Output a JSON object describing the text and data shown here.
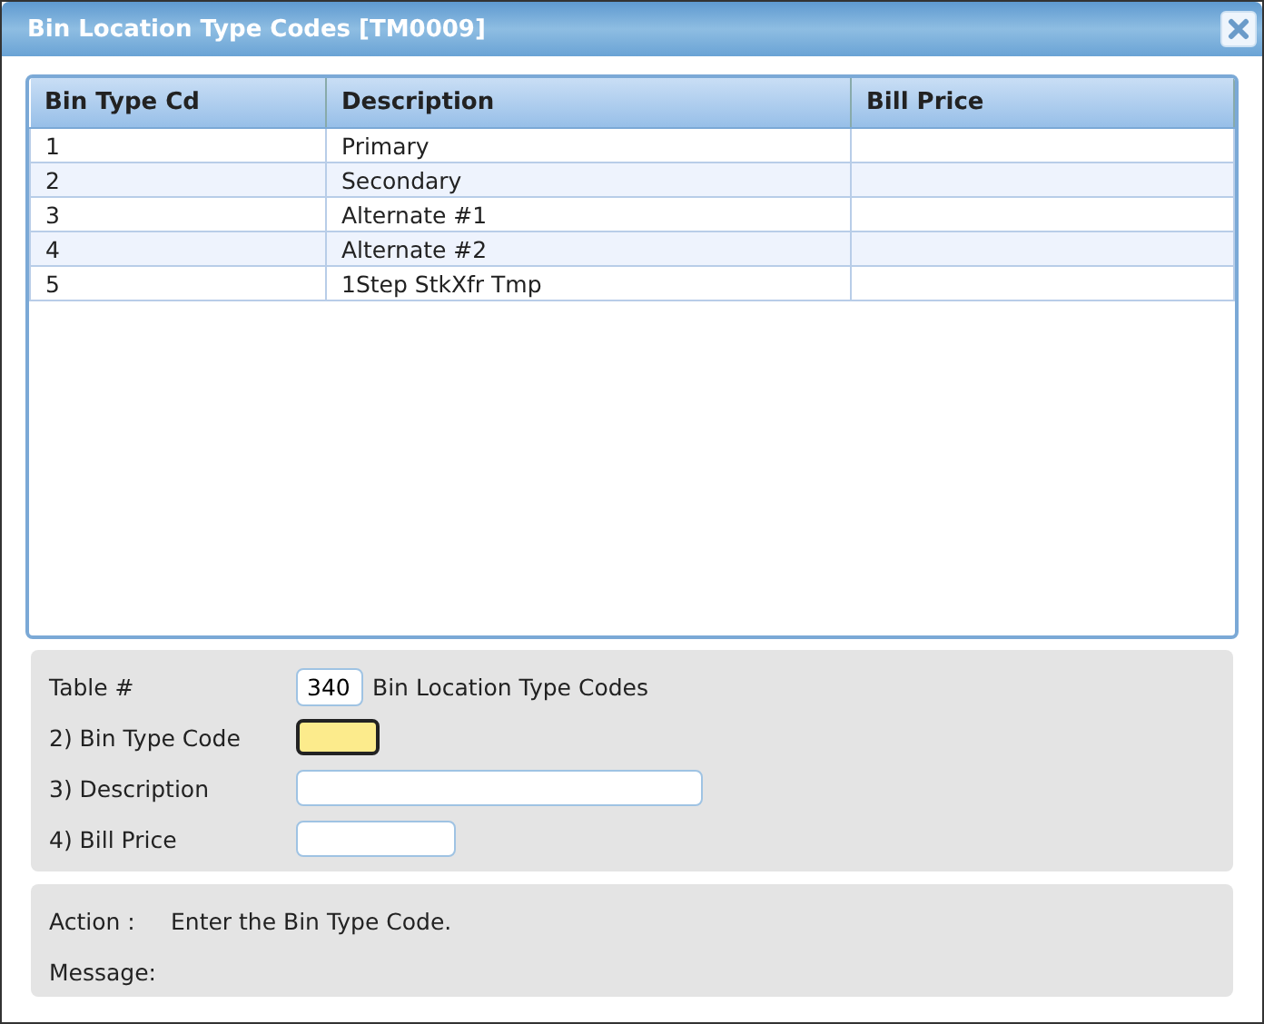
{
  "window": {
    "title": "Bin Location Type Codes [TM0009]"
  },
  "table": {
    "columns": [
      "Bin Type Cd",
      "Description",
      "Bill Price"
    ],
    "rows": [
      {
        "cells": [
          "1",
          "Primary",
          ""
        ]
      },
      {
        "cells": [
          "2",
          "Secondary",
          ""
        ]
      },
      {
        "cells": [
          "3",
          "Alternate #1",
          ""
        ]
      },
      {
        "cells": [
          "4",
          "Alternate #2",
          ""
        ]
      },
      {
        "cells": [
          "5",
          "1Step StkXfr Tmp",
          ""
        ]
      }
    ]
  },
  "form": {
    "table_number": {
      "label": "Table #",
      "value": "340",
      "name": "Bin Location Type Codes"
    },
    "fields": [
      {
        "label": "2) Bin Type Code",
        "focused": true
      },
      {
        "label": "3) Description",
        "focused": false
      },
      {
        "label": "4) Bill Price",
        "focused": false
      }
    ]
  },
  "status": {
    "action_label": "Action :",
    "action": "Enter the Bin Type Code.",
    "message_label": "Message:"
  }
}
